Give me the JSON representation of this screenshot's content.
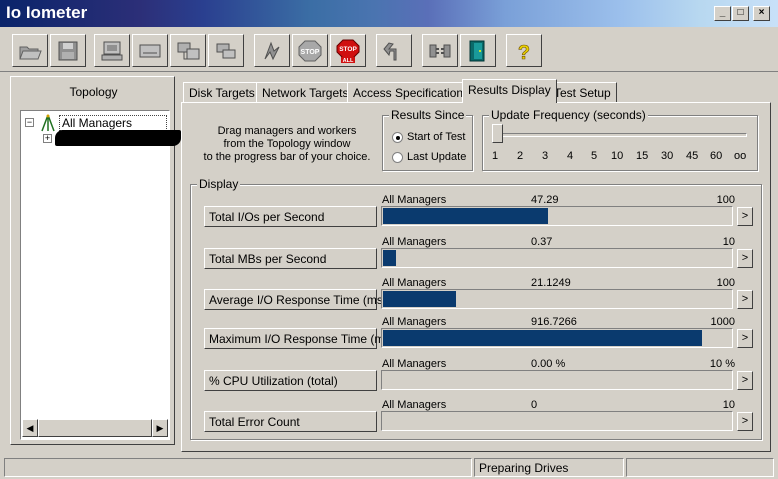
{
  "app": {
    "title_prefix": "Io",
    "title": " Iometer"
  },
  "window_controls": {
    "minimize": "_",
    "maximize": "□",
    "close": "×"
  },
  "toolbar": [
    {
      "name": "open-icon"
    },
    {
      "name": "save-icon"
    },
    {
      "name": "start-disk-worker-icon"
    },
    {
      "name": "start-network-worker-icon"
    },
    {
      "name": "duplicate-worker-icon"
    },
    {
      "name": "new-manager-icon"
    },
    {
      "name": "start-tests-icon"
    },
    {
      "name": "stop-icon"
    },
    {
      "name": "stop-all-icon"
    },
    {
      "name": "reset-workers-icon"
    },
    {
      "name": "disconnect-workers-icon"
    },
    {
      "name": "exit-icon"
    },
    {
      "name": "help-icon"
    }
  ],
  "topology": {
    "title": "Topology",
    "root": "All Managers",
    "toggle_root": "−",
    "toggle_child": "+"
  },
  "tabs": [
    "Disk Targets",
    "Network Targets",
    "Access Specifications",
    "Results Display",
    "Test Setup"
  ],
  "active_tab": "Results Display",
  "instructions": [
    "Drag managers and workers",
    "from the Topology window",
    "to the progress bar of your choice."
  ],
  "results_since": {
    "title": "Results Since",
    "options": [
      "Start of Test",
      "Last Update"
    ],
    "selected": "Start of Test"
  },
  "update_frequency": {
    "title": "Update Frequency (seconds)",
    "ticks": [
      "1",
      "2",
      "3",
      "4",
      "5",
      "10",
      "15",
      "30",
      "45",
      "60",
      "oo"
    ],
    "value": "1"
  },
  "display": {
    "title": "Display",
    "rows": [
      {
        "label": "Total I/Os per Second",
        "target": "All Managers",
        "value": "47.29",
        "max": "100",
        "fraction": 0.4729
      },
      {
        "label": "Total MBs per Second",
        "target": "All Managers",
        "value": "0.37",
        "max": "10",
        "fraction": 0.037
      },
      {
        "label": "Average I/O Response Time (ms)",
        "target": "All Managers",
        "value": "21.1249",
        "max": "100",
        "fraction": 0.2112
      },
      {
        "label": "Maximum I/O Response Time (ms)",
        "target": "All Managers",
        "value": "916.7266",
        "max": "1000",
        "fraction": 0.9167
      },
      {
        "label": "% CPU Utilization (total)",
        "target": "All Managers",
        "value": "0.00 %",
        "max": "10 %",
        "fraction": 0
      },
      {
        "label": "Total Error Count",
        "target": "All Managers",
        "value": "0",
        "max": "10",
        "fraction": 0
      }
    ],
    "expand_symbol": ">"
  },
  "statusbar": {
    "left": "",
    "middle": "Preparing Drives",
    "right": ""
  },
  "colors": {
    "bar_fill": "#0a3a6e",
    "face": "#d4d0c8"
  }
}
